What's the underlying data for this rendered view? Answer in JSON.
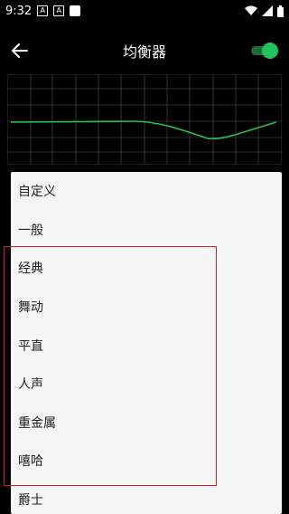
{
  "status_bar": {
    "time": "9:32",
    "notification_icons": [
      "a-box-icon",
      "a-box-icon",
      "solid-square-icon"
    ],
    "notif_letter_1": "A",
    "notif_letter_2": "A",
    "right_icons": [
      "wifi-icon",
      "signal-icon",
      "battery-icon"
    ]
  },
  "app_bar": {
    "title": "均衡器",
    "back_icon": "arrow-left-icon",
    "toggle_on": true
  },
  "colors": {
    "background": "#000000",
    "accent_green": "#22c35a",
    "curve_green": "#2bc04e",
    "menu_bg": "#f5f5f5",
    "highlight_red": "#d61f26"
  },
  "menu": {
    "items": [
      {
        "label": "自定义"
      },
      {
        "label": "一般"
      },
      {
        "label": "经典"
      },
      {
        "label": "舞动"
      },
      {
        "label": "平直"
      },
      {
        "label": "人声"
      },
      {
        "label": "重金属"
      },
      {
        "label": "嘻哈"
      },
      {
        "label": "爵士"
      }
    ]
  }
}
